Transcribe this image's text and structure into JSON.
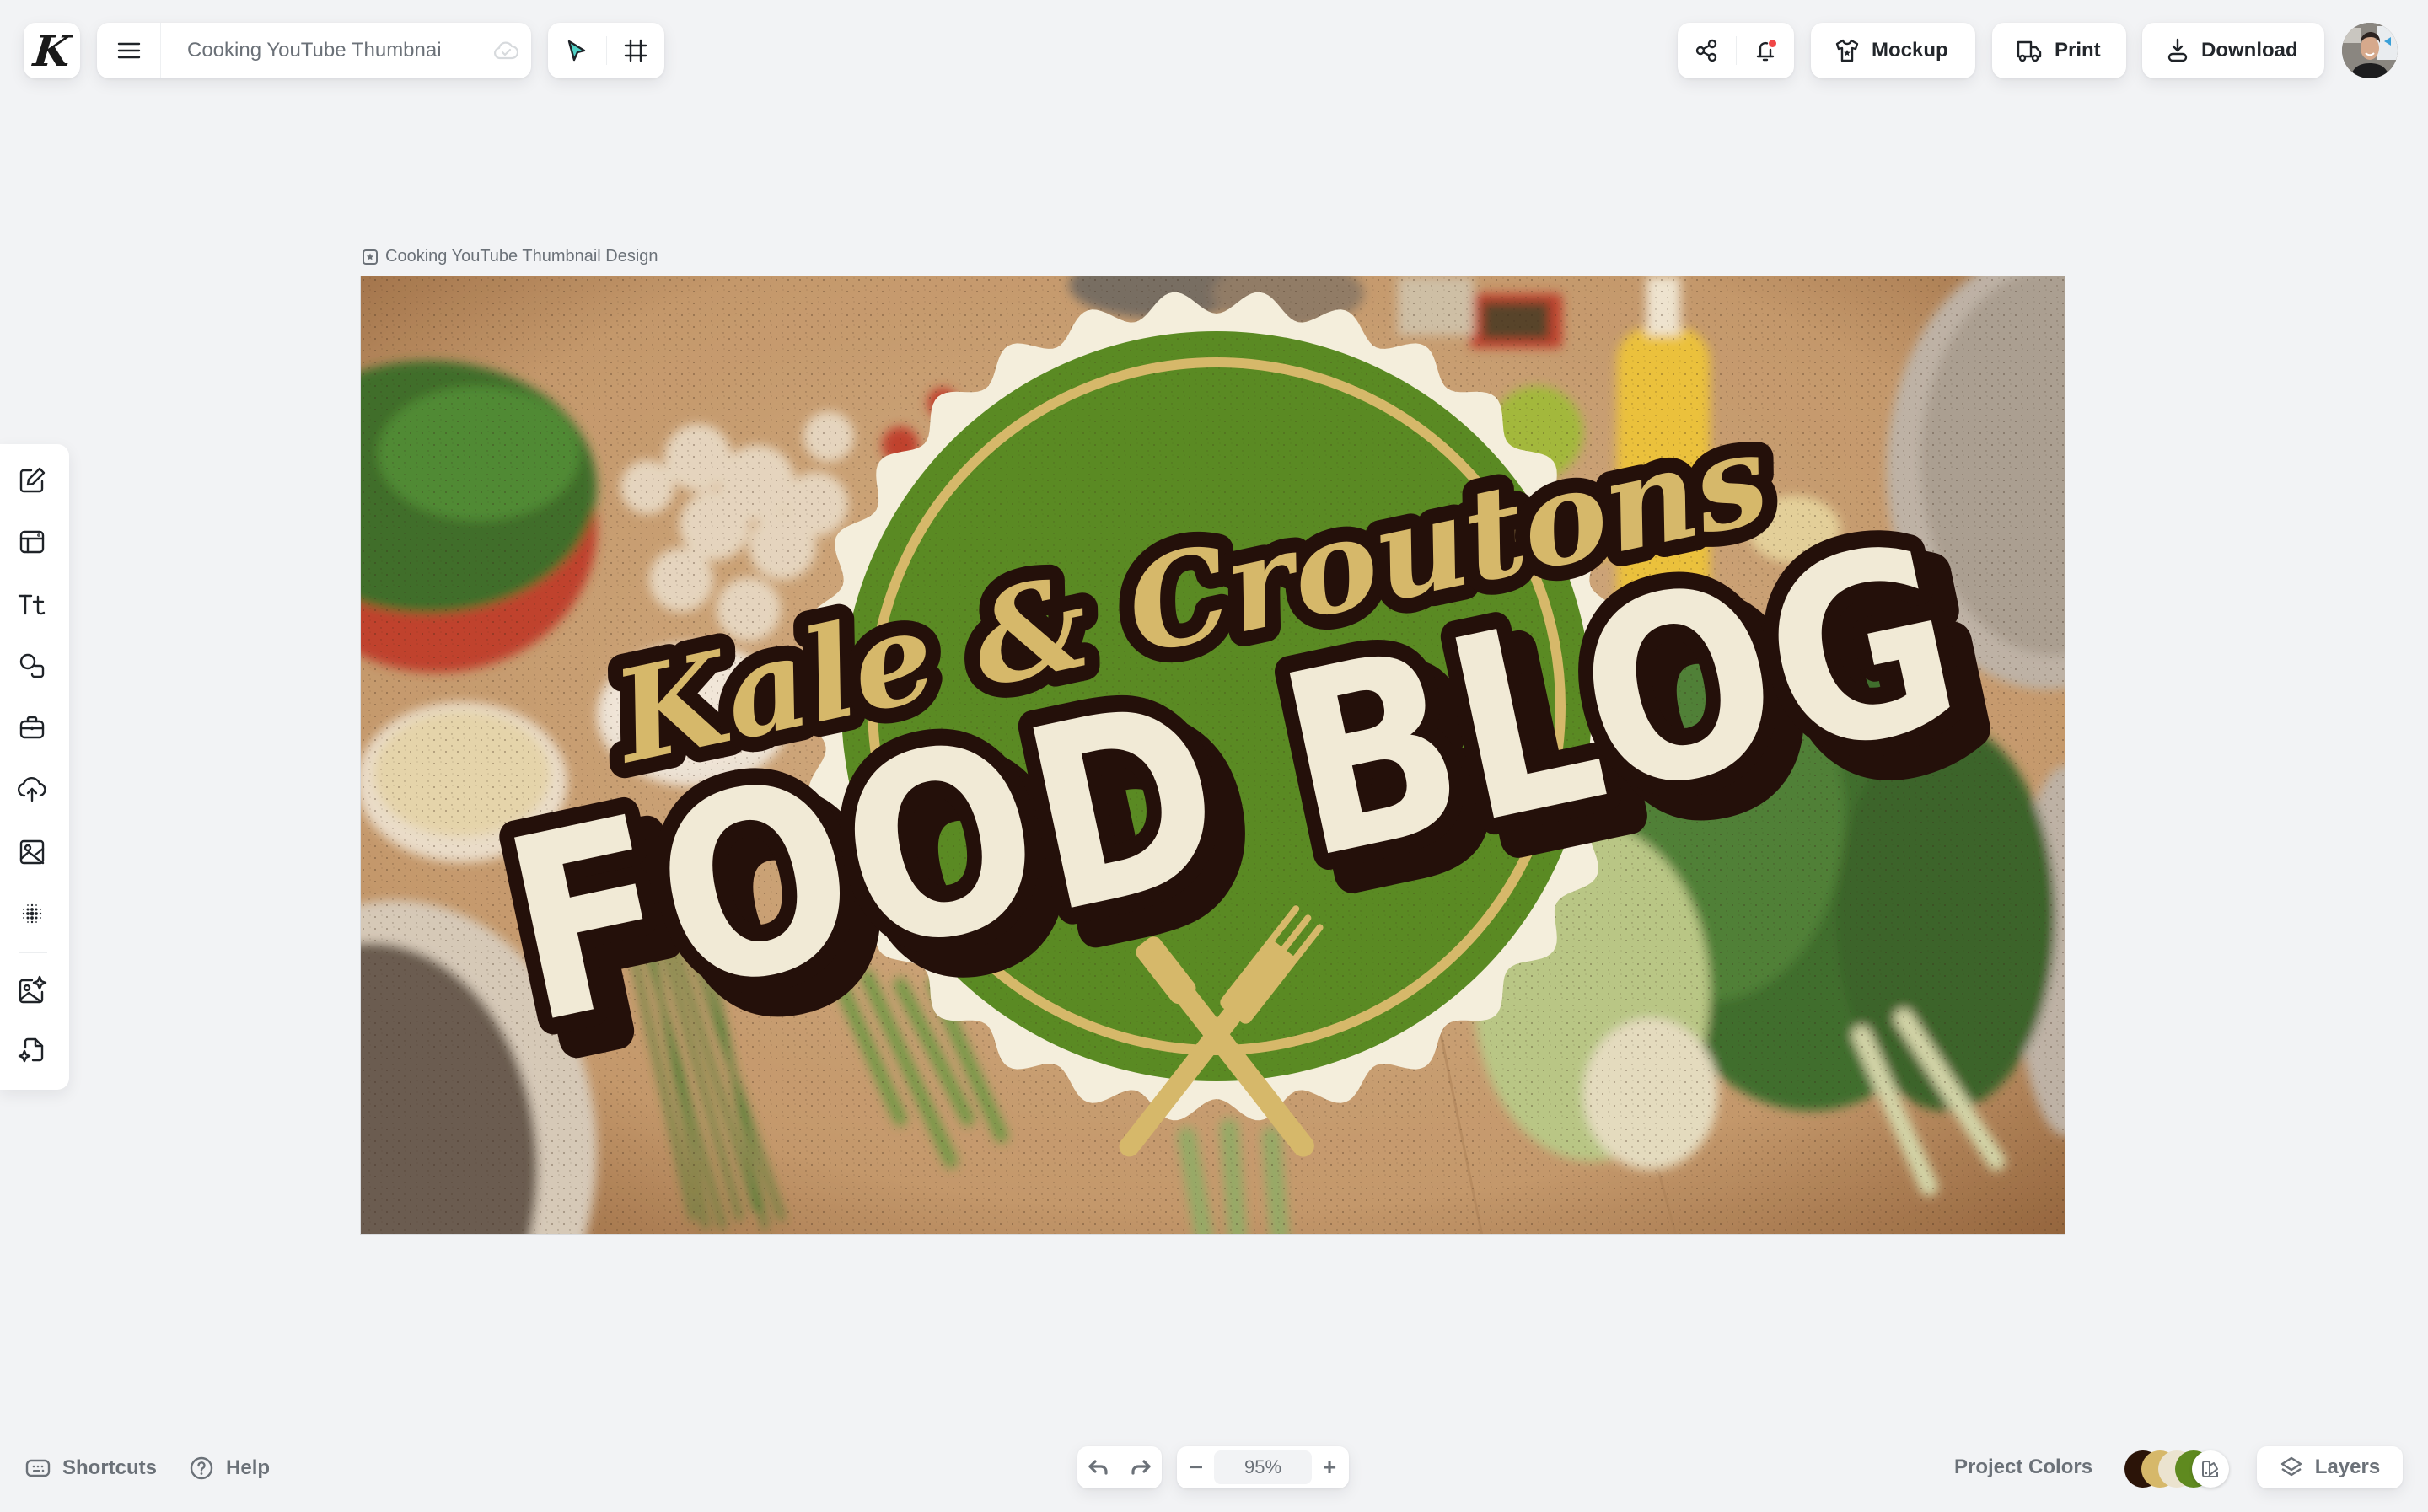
{
  "app": {
    "logo_letter": "K"
  },
  "header": {
    "document_title": "Cooking YouTube Thumbnai",
    "buttons": {
      "mockup": "Mockup",
      "print": "Print",
      "download": "Download"
    },
    "notification_badge": true
  },
  "canvas": {
    "label": "Cooking YouTube Thumbnail Design",
    "design": {
      "script_text": "Kale & Croutons",
      "headline": "FOOD BLOG",
      "emblem": "fork-and-knife"
    }
  },
  "sidebar": {
    "items": [
      {
        "name": "edit",
        "icon": "pencil-square-icon"
      },
      {
        "name": "templates",
        "icon": "layout-icon"
      },
      {
        "name": "text",
        "icon": "text-icon"
      },
      {
        "name": "shapes",
        "icon": "shapes-icon"
      },
      {
        "name": "brand",
        "icon": "briefcase-icon"
      },
      {
        "name": "uploads",
        "icon": "cloud-upload-icon"
      },
      {
        "name": "images",
        "icon": "image-icon"
      },
      {
        "name": "patterns",
        "icon": "halftone-icon"
      },
      {
        "name": "ai-image",
        "icon": "sparkle-image-icon"
      },
      {
        "name": "ai-tools",
        "icon": "sparkle-file-icon"
      }
    ]
  },
  "footer": {
    "shortcuts": "Shortcuts",
    "help": "Help",
    "zoom_level": "95%",
    "zoom_out": "−",
    "zoom_in": "+",
    "project_colors_label": "Project Colors",
    "project_colors": [
      "#2b1408",
      "#d6b86a",
      "#ebe3cf",
      "#5f8a1f"
    ],
    "layers": "Layers"
  },
  "colors": {
    "brand_green": "#5a8a23",
    "brand_gold": "#d6b86a",
    "brand_cream": "#f1ead6",
    "brand_brown": "#24100a",
    "accent_teal": "#4fd1c5",
    "notify_red": "#f04747"
  }
}
